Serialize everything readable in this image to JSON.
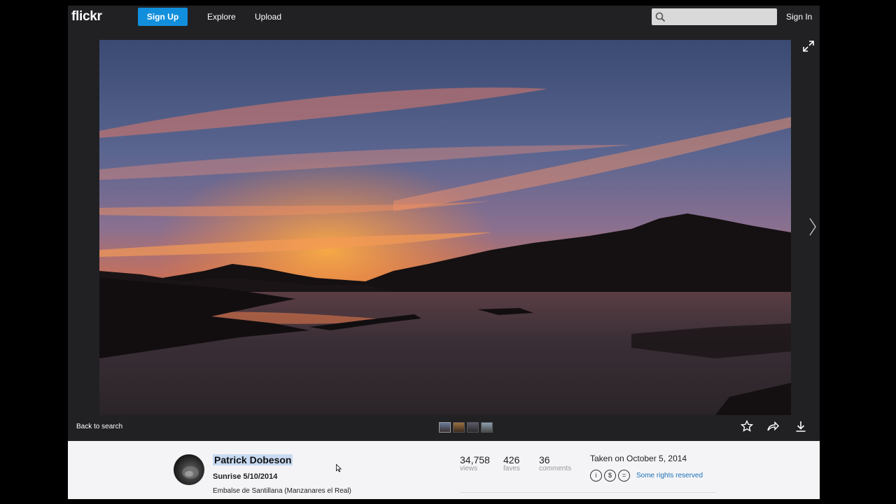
{
  "header": {
    "logo": "flickr",
    "signup_label": "Sign Up",
    "nav": [
      "Explore",
      "Upload"
    ],
    "search_placeholder": "",
    "signin_label": "Sign In"
  },
  "viewer": {
    "back_label": "Back to search",
    "thumbnails_count": 4,
    "icons": [
      "star-icon",
      "share-icon",
      "download-icon",
      "expand-icon",
      "chevron-right-icon"
    ]
  },
  "photo_info": {
    "author": "Patrick Dobeson",
    "title": "Sunrise 5/10/2014",
    "description": "Embalse de Santillana (Manzanares el Real)",
    "stats": [
      {
        "value": "34,758",
        "label": "views"
      },
      {
        "value": "426",
        "label": "faves"
      },
      {
        "value": "36",
        "label": "comments"
      }
    ],
    "taken": "Taken on October 5, 2014",
    "license_text": "Some rights reserved"
  },
  "colors": {
    "frame_bg": "#212124",
    "signup_blue": "#128fdc",
    "info_bg": "#f4f4f6",
    "link_blue": "#1c70b8"
  }
}
